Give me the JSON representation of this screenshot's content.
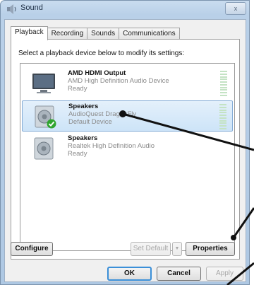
{
  "window": {
    "title": "Sound",
    "close_glyph": "x"
  },
  "tabs": [
    {
      "label": "Playback",
      "active": true
    },
    {
      "label": "Recording",
      "active": false
    },
    {
      "label": "Sounds",
      "active": false
    },
    {
      "label": "Communications",
      "active": false
    }
  ],
  "instruction": "Select a playback device below to modify its settings:",
  "devices": [
    {
      "name": "AMD HDMI Output",
      "line1": "AMD High Definition Audio Device",
      "line2": "Ready",
      "icon": "monitor-icon",
      "selected": false,
      "default": false
    },
    {
      "name": "Speakers",
      "line1": "AudioQuest DragonFly",
      "line2": "Default Device",
      "icon": "speaker-icon",
      "selected": true,
      "default": true
    },
    {
      "name": "Speakers",
      "line1": "Realtek High Definition Audio",
      "line2": "Ready",
      "icon": "speaker-icon",
      "selected": false,
      "default": false
    }
  ],
  "buttons": {
    "configure": "Configure",
    "set_default": "Set Default",
    "set_default_arrow": "▼",
    "properties": "Properties",
    "ok": "OK",
    "cancel": "Cancel",
    "apply": "Apply"
  },
  "colors": {
    "selection": "#cde4f8",
    "default_check": "#2fa52f",
    "meter": "#c4e3c4"
  }
}
